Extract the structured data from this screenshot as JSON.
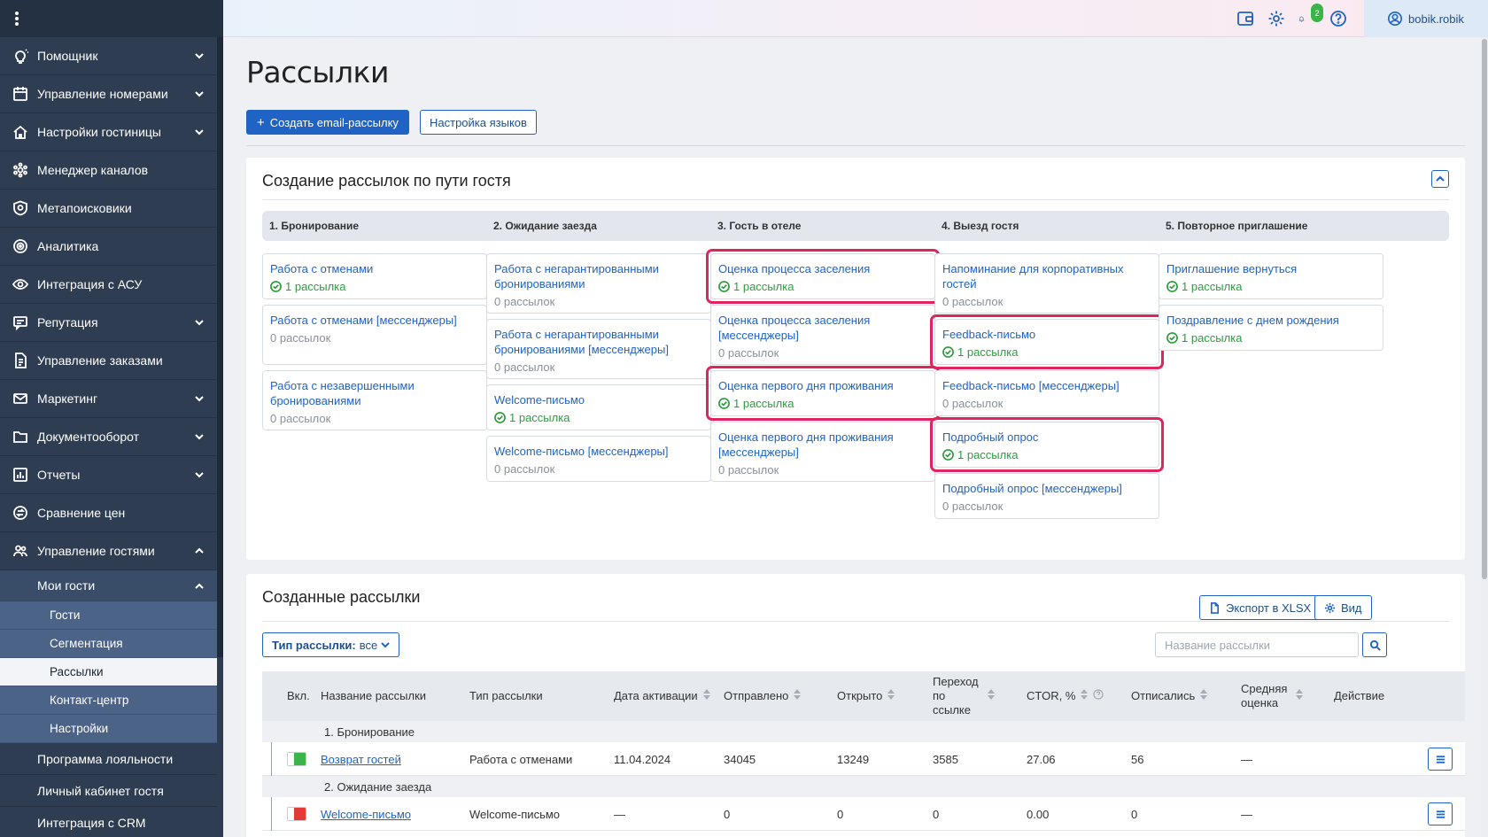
{
  "sidebar": {
    "menu_icon": "kebab-menu-icon",
    "items": [
      {
        "label": "Помощник",
        "icon": "lightbulb-icon",
        "chevron": true
      },
      {
        "label": "Управление номерами",
        "icon": "calendar-icon",
        "chevron": true
      },
      {
        "label": "Настройки гостиницы",
        "icon": "hotel-icon",
        "chevron": true
      },
      {
        "label": "Менеджер каналов",
        "icon": "hexagon-network-icon",
        "chevron": false
      },
      {
        "label": "Метапоисковики",
        "icon": "search-shield-icon",
        "chevron": false
      },
      {
        "label": "Аналитика",
        "icon": "target-icon",
        "chevron": false
      },
      {
        "label": "Интеграция с АСУ",
        "icon": "eye-icon",
        "chevron": false
      },
      {
        "label": "Репутация",
        "icon": "chat-icon",
        "chevron": true
      },
      {
        "label": "Управление заказами",
        "icon": "document-icon",
        "chevron": false
      },
      {
        "label": "Маркетинг",
        "icon": "mail-icon",
        "chevron": true
      },
      {
        "label": "Документооборот",
        "icon": "folder-icon",
        "chevron": true
      },
      {
        "label": "Отчеты",
        "icon": "bar-chart-icon",
        "chevron": true
      },
      {
        "label": "Сравнение цен",
        "icon": "price-compare-icon",
        "chevron": false
      },
      {
        "label": "Управление гостями",
        "icon": "users-icon",
        "chevron": true
      }
    ],
    "sub_section": "Мои гости",
    "sub_items": [
      "Гости",
      "Сегментация",
      "Рассылки",
      "Контакт-центр",
      "Настройки"
    ],
    "active_sub": "Рассылки",
    "bottom_items": [
      "Программа лояльности",
      "Личный кабинет гостя",
      "Интеграция с CRM"
    ]
  },
  "header": {
    "notifications_count": "2",
    "username": "bobik.robik"
  },
  "page": {
    "title": "Рассылки",
    "create_button": "Создать email-рассылку",
    "languages_button": "Настройка языков"
  },
  "journey": {
    "title": "Создание рассылок по пути гостя",
    "stages": [
      "1. Бронирование",
      "2. Ожидание заезда",
      "3. Гость в отеле",
      "4. Выезд гостя",
      "5. Повторное приглашение"
    ],
    "columns": [
      [
        {
          "title": "Работа с отменами",
          "status": "1 рассылка",
          "active": true,
          "highlight": false
        },
        {
          "title": "Работа с отменами [мессенджеры]",
          "status": "0 рассылок",
          "active": false,
          "highlight": false
        },
        {
          "title": "Работа с незавершенными бронированиями",
          "status": "0 рассылок",
          "active": false,
          "highlight": false
        }
      ],
      [
        {
          "title": "Работа с негарантированными бронированиями",
          "status": "0 рассылок",
          "active": false,
          "highlight": false
        },
        {
          "title": "Работа с негарантированными бронированиями [мессенджеры]",
          "status": "0 рассылок",
          "active": false,
          "highlight": false
        },
        {
          "title": "Welcome-письмо",
          "status": "1 рассылка",
          "active": true,
          "highlight": false
        },
        {
          "title": "Welcome-письмо [мессенджеры]",
          "status": "0 рассылок",
          "active": false,
          "highlight": false
        }
      ],
      [
        {
          "title": "Оценка процесса заселения",
          "status": "1 рассылка",
          "active": true,
          "highlight": true
        },
        {
          "title": "Оценка процесса заселения [мессенджеры]",
          "status": "0 рассылок",
          "active": false,
          "highlight": false
        },
        {
          "title": "Оценка первого дня проживания",
          "status": "1 рассылка",
          "active": true,
          "highlight": true
        },
        {
          "title": "Оценка первого дня проживания [мессенджеры]",
          "status": "0 рассылок",
          "active": false,
          "highlight": false
        }
      ],
      [
        {
          "title": "Напоминание для корпоративных гостей",
          "status": "0 рассылок",
          "active": false,
          "highlight": false
        },
        {
          "title": "Feedback-письмо",
          "status": "1 рассылка",
          "active": true,
          "highlight": true
        },
        {
          "title": "Feedback-письмо [мессенджеры]",
          "status": "0 рассылок",
          "active": false,
          "highlight": false
        },
        {
          "title": "Подробный опрос",
          "status": "1 рассылка",
          "active": true,
          "highlight": true
        },
        {
          "title": "Подробный опрос [мессенджеры]",
          "status": "0 рассылок",
          "active": false,
          "highlight": false
        }
      ],
      [
        {
          "title": "Приглашение вернуться",
          "status": "1 рассылка",
          "active": true,
          "highlight": false
        },
        {
          "title": "Поздравление с днем рождения",
          "status": "1 рассылка",
          "active": true,
          "highlight": false
        }
      ]
    ]
  },
  "created": {
    "title": "Созданные рассылки",
    "export_button": "Экспорт в XLSX",
    "view_button": "Вид",
    "filter_label": "Тип рассылки:",
    "filter_value": "все",
    "search_placeholder": "Название рассылки",
    "columns": [
      "Вкл.",
      "Название рассылки",
      "Тип рассылки",
      "Дата активации",
      "Отправлено",
      "Открыто",
      "Переход по ссылке",
      "CTOR, %",
      "Отписались",
      "Средняя оценка",
      "Действие"
    ],
    "groups": [
      {
        "label": "1. Бронирование",
        "rows": [
          {
            "enabled": true,
            "name": "Возврат гостей",
            "type": "Работа с отменами",
            "date": "11.04.2024",
            "sent": "34045",
            "opened": "13249",
            "clicks": "3585",
            "ctor": "27.06",
            "unsub": "56",
            "rating": "—"
          }
        ]
      },
      {
        "label": "2. Ожидание заезда",
        "rows": [
          {
            "enabled": false,
            "name": "Welcome-письмо",
            "type": "Welcome-письмо",
            "date": "—",
            "sent": "0",
            "opened": "0",
            "clicks": "0",
            "ctor": "0.00",
            "unsub": "0",
            "rating": "—"
          }
        ]
      }
    ]
  },
  "colors": {
    "accent": "#1f63c4",
    "highlight": "#e0245e",
    "success": "#2e9b3f",
    "sidebar": "#2f3d52"
  }
}
